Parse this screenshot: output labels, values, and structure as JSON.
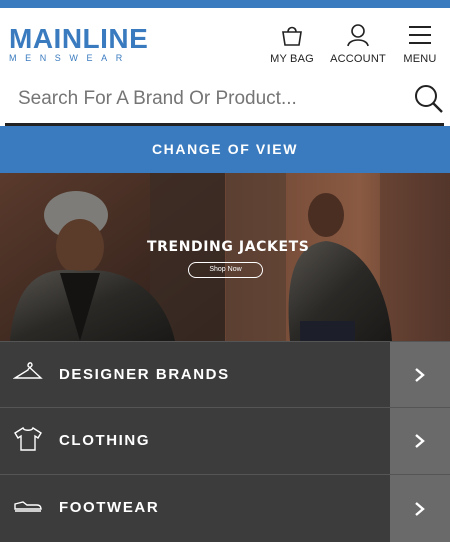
{
  "header": {
    "logo_main": "MAINLINE",
    "logo_sub": "MENSWEAR",
    "bag_label": "MY BAG",
    "account_label": "ACCOUNT",
    "menu_label": "MENU"
  },
  "search": {
    "placeholder": "Search For A Brand Or Product..."
  },
  "change_view_label": "CHANGE OF VIEW",
  "banner": {
    "title": "TRENDING JACKETS",
    "button_label": "Shop Now"
  },
  "categories": [
    {
      "label": "DESIGNER BRANDS",
      "icon": "hanger-icon"
    },
    {
      "label": "CLOTHING",
      "icon": "tshirt-icon"
    },
    {
      "label": "FOOTWEAR",
      "icon": "shoe-icon"
    }
  ],
  "colors": {
    "brand": "#3a7bbf",
    "category_bg": "#3c3c3c",
    "arrow_bg": "#6a6a6a"
  }
}
